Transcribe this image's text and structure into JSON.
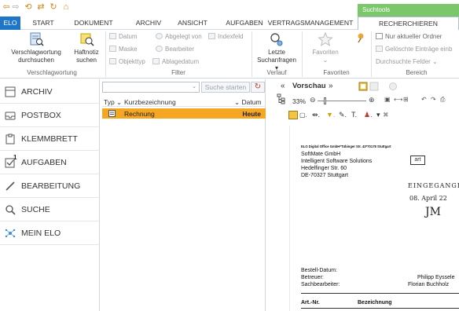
{
  "context_tab_group": "Suchtools",
  "tabs": [
    {
      "label": "ELO"
    },
    {
      "label": "START"
    },
    {
      "label": "DOKUMENT"
    },
    {
      "label": "ARCHIV"
    },
    {
      "label": "ANSICHT"
    },
    {
      "label": "AUFGABEN"
    },
    {
      "label": "VERTRAGSMANAGEMENT"
    },
    {
      "label": "RECHERCHIEREN"
    }
  ],
  "ribbon": {
    "groups": {
      "verschlagwortung": "Verschlagwortung",
      "filter": "Filter",
      "verlauf": "Verlauf",
      "favoriten": "Favoriten",
      "bereich": "Bereich"
    },
    "verschlagwortung_btn": {
      "line1": "Verschlagwortung",
      "line2": "durchsuchen"
    },
    "haftnotiz_btn": {
      "line1": "Haftnotiz",
      "line2": "suchen"
    },
    "filter_items": {
      "datum": "Datum",
      "abgelegt_von": "Abgelegt von",
      "indexfeld": "Indexfeld",
      "maske": "Maske",
      "bearbeiter": "Bearbeiter",
      "objekttyp": "Objekttyp",
      "ablagedatum": "Ablagedatum"
    },
    "letzte_btn": {
      "line1": "Letzte",
      "line2": "Suchanfragen ▾"
    },
    "favoriten_btn": {
      "line1": "Favoriten",
      "line2": "⌄"
    },
    "bereich_items": {
      "nur_aktueller": "Nur aktueller Ordner",
      "geloeschte": "Gelöschte Einträge einb",
      "durchsuchte": "Durchsuchte Felder ⌄"
    }
  },
  "sidebar": {
    "items": [
      {
        "label": "ARCHIV"
      },
      {
        "label": "POSTBOX"
      },
      {
        "label": "KLEMMBRETT"
      },
      {
        "label": "AUFGABEN",
        "badge": "1"
      },
      {
        "label": "BEARBEITUNG"
      },
      {
        "label": "SUCHE"
      },
      {
        "label": "MEIN ELO"
      }
    ]
  },
  "search": {
    "value": "",
    "start_label": "Suche starten",
    "reset_glyph": "↻"
  },
  "list": {
    "columns": [
      "Typ ⌄",
      "Kurzbezeichnung",
      "⌄ Datum"
    ],
    "rows": [
      {
        "name": "Rechnung",
        "date": "Heute"
      }
    ]
  },
  "preview": {
    "collapse": "«",
    "title": "Vorschau",
    "expand": "»",
    "zoom": "33%",
    "doc": {
      "sender_line": "ELO Digital Office GmbH*Tübinger Str. 43*70178 Stuttgart",
      "recipient": [
        "SoftMate GmbH",
        "Intelligent Software Solutions",
        "Hedelfinger Str. 60",
        "DE-70327 Stuttgart"
      ],
      "stamp_box": "art",
      "handwritten": [
        "EINGEGANGEN",
        "08. April 22",
        "JM"
      ],
      "fields": [
        "Bestell-Datum:",
        "Betreuer:",
        "Sachbearbeiter:"
      ],
      "field_values": [
        "Philipp Eyssele",
        "Florian Buchholz"
      ],
      "table_head": [
        "Art.-Nr.",
        "Bezeichnung"
      ]
    }
  },
  "colors": {
    "accent": "#1f76c6",
    "highlight": "#f5a623",
    "context": "#7bc86c"
  }
}
